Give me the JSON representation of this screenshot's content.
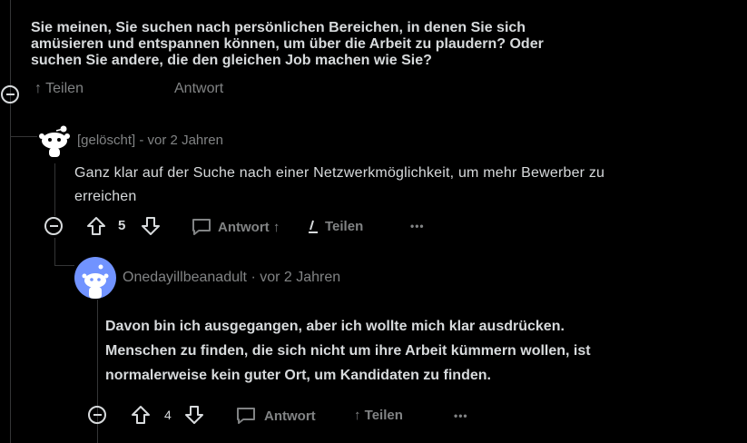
{
  "comment_top": {
    "text_line1": "Sie meinen, Sie suchen nach persönlichen Bereichen, in denen Sie sich",
    "text_line2": "amüsieren und entspannen können, um über die Arbeit zu plaudern? Oder",
    "text_line3": "suchen Sie andere, die den gleichen Job machen wie Sie?",
    "share_label": "↑ Teilen",
    "reply_label": "Antwort"
  },
  "comment_deleted": {
    "author": "[gelöscht]",
    "age": " - vor 2 Jahren",
    "text_line1": "Ganz klar auf der Suche nach einer Netzwerkmöglichkeit, um mehr Bewerber zu",
    "text_line2": "erreichen",
    "votes": "5",
    "reply_label": "Antwort ↑",
    "share_label": "Teilen",
    "more_label": "•••"
  },
  "comment_reply": {
    "author": "Onedayillbeanadult",
    "age": " · vor 2 Jahren",
    "text_line1": "Davon bin ich ausgegangen, aber ich wollte mich klar ausdrücken.",
    "text_line2": "Menschen zu finden, die sich nicht um ihre Arbeit kümmern wollen, ist",
    "text_line3": "normalerweise kein guter Ort, um Kandidaten zu finden.",
    "votes": "4",
    "reply_label": "Antwort",
    "share_label": "↑ Teilen",
    "more_label": "•••"
  },
  "colors": {
    "background": "#000000",
    "text": "#d7dadc",
    "muted": "#818384",
    "avatar_blue": "#7193ff"
  }
}
